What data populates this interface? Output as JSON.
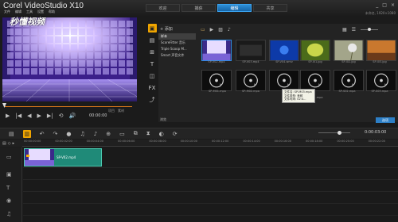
{
  "app": {
    "title": "Corel VideoStudio X10"
  },
  "menu": [
    "文件",
    "编辑",
    "工具",
    "设置",
    "帮助"
  ],
  "window_controls": [
    "_",
    "□",
    "×"
  ],
  "tabs": [
    {
      "label": "欢迎",
      "active": false
    },
    {
      "label": "捕获",
      "active": false
    },
    {
      "label": "编辑",
      "active": true
    },
    {
      "label": "共享",
      "active": false
    }
  ],
  "project_info": "未命名, 1920×1080",
  "preview": {
    "watermark": "秒懂视频",
    "timecode": "00:00:00",
    "mode_labels": [
      "项目",
      "素材"
    ]
  },
  "library": {
    "add_label": "+ 添加",
    "items": [
      {
        "label": "样本",
        "active": true
      },
      {
        "label": "ScoreFitter 音乐",
        "active": false
      },
      {
        "label": "Triple Scoop M...",
        "active": false
      },
      {
        "label": "Smart 声音文件",
        "active": false
      }
    ],
    "browse_label": "浏览",
    "options_label": "选项",
    "thumbnails": [
      {
        "caption": "SP-V02.mp4",
        "kind": "video",
        "selected": true
      },
      {
        "caption": "SP-V03.mp4",
        "kind": "video",
        "selected": false
      },
      {
        "caption": "SP-V04.wmv",
        "kind": "video",
        "selected": false
      },
      {
        "caption": "SP-I01.jpg",
        "kind": "image",
        "selected": false
      },
      {
        "caption": "SP-I02.jpg",
        "kind": "image",
        "selected": false
      },
      {
        "caption": "SP-I03.jpg",
        "kind": "image",
        "selected": false
      },
      {
        "caption": "SP-M01.mpa",
        "kind": "audio",
        "selected": false
      },
      {
        "caption": "SP-M02.mpa",
        "kind": "audio",
        "selected": false
      },
      {
        "caption": "SP-M03.mpa",
        "kind": "audio",
        "selected": false
      },
      {
        "caption": "SP-S01.mpa",
        "kind": "audio",
        "selected": false
      },
      {
        "caption": "SP-S02.mpa",
        "kind": "audio",
        "selected": false
      },
      {
        "caption": "SP-S03.mpa",
        "kind": "audio",
        "selected": false
      }
    ],
    "tooltip": [
      "文件名: SP-M03.mpa",
      "文件类型: 音频",
      "文件时间: 02:4..."
    ]
  },
  "timeline": {
    "timecode": "0:00:03:00",
    "ruler_labels": [
      "00:00:00:00",
      "00:00:02:00",
      "00:00:04:00",
      "00:00:06:00",
      "00:00:08:00",
      "00:00:10:00",
      "00:00:12:00",
      "00:00:14:00",
      "00:00:16:00",
      "00:00:18:00",
      "00:00:20:00",
      "00:00:22:00"
    ],
    "clip": {
      "label": "SP-V02.mp4"
    }
  },
  "icons": {
    "play": "▶",
    "prev": "|◀",
    "rewind": "◀",
    "forward": "▶",
    "next": "▶|",
    "repeat": "⟲",
    "volume": "🔊"
  }
}
